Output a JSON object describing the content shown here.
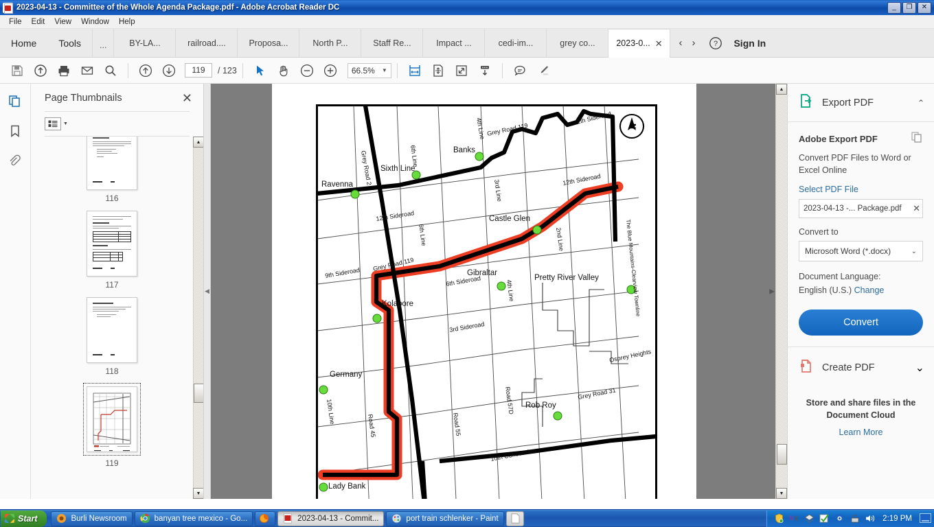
{
  "window": {
    "title": "2023-04-13 - Committee of the Whole Agenda Package.pdf - Adobe Acrobat Reader DC",
    "minimize": "_",
    "restore": "❐",
    "close": "✕"
  },
  "menubar": {
    "items": [
      "File",
      "Edit",
      "View",
      "Window",
      "Help"
    ]
  },
  "tabstrip": {
    "home": "Home",
    "tools": "Tools",
    "ellipsis": "...",
    "docs": [
      "BY-LA...",
      "railroad....",
      "Proposa...",
      "North P...",
      "Staff Re...",
      "Impact ...",
      "cedi-im...",
      "grey co..."
    ],
    "active_tab": "2023-0...",
    "active_close": "✕",
    "prev_arrow": "‹",
    "next_arrow": "›",
    "help": "?",
    "sign_in": "Sign In"
  },
  "toolbar": {
    "save": "save-icon",
    "upload": "upload-cloud-icon",
    "print": "print-icon",
    "email": "email-icon",
    "search": "search-icon",
    "page_up": "page-up-icon",
    "page_down": "page-down-icon",
    "page_current": "119",
    "page_total": "/ 123",
    "select_tool": "cursor-icon",
    "hand_tool": "hand-icon",
    "zoom_out": "zoom-out-icon",
    "zoom_in": "zoom-in-icon",
    "zoom_level": "66.5%",
    "zoom_caret": "▼",
    "fit_width": "fit-width-icon",
    "fit_page": "fit-page-icon",
    "fullscreen": "fullscreen-icon",
    "scroll_mode": "scroll-down-icon",
    "comment": "comment-icon",
    "highlight": "highlighter-icon"
  },
  "rail": {
    "thumbnails": "page-thumbnails-icon",
    "bookmarks": "bookmark-icon",
    "attachments": "attachment-icon"
  },
  "thumbnails_panel": {
    "title": "Page Thumbnails",
    "close": "✕",
    "list_button": "list-view-icon",
    "list_caret": "▼",
    "pages": [
      {
        "number": "116",
        "kind": "text"
      },
      {
        "number": "117",
        "kind": "table"
      },
      {
        "number": "118",
        "kind": "text"
      },
      {
        "number": "119",
        "kind": "map",
        "selected": true
      }
    ],
    "scroll_up": "▲",
    "scroll_down": "▼"
  },
  "document": {
    "scroll_up": "▲",
    "scroll_down": "▼",
    "collapse_handle": "▶",
    "expand_handle": "◀"
  },
  "map": {
    "compass_label": "N",
    "places": [
      "Ravenna",
      "Sixth Line",
      "Banks",
      "Castle Glen",
      "Gibraltar",
      "Kolapore",
      "Germany",
      "Pretty River Valley",
      "Rob Roy",
      "Osprey Heights",
      "Lady Bank"
    ],
    "roads": [
      "Grey Road 2",
      "Grey Road 119",
      "Grey Road 31",
      "4th Line",
      "6th Line",
      "3rd Line",
      "2nd Line",
      "12th Sideroad",
      "9th Sideroad",
      "6th Sideroad",
      "3rd Sideroad",
      "10th Line",
      "10th Concession",
      "Road 45",
      "Road 55",
      "Road 57D",
      "The Blue Mountains-Clearview Townline"
    ],
    "highlight_color": "#ed3d22",
    "node_color": "#66dd3a"
  },
  "export_panel": {
    "header": "Export PDF",
    "header_icon": "export-pdf-icon",
    "collapse_chevron": "⌃",
    "heading": "Adobe Export PDF",
    "heading_icon": "copy-docs-icon",
    "description": "Convert PDF Files to Word or Excel Online",
    "select_file_link": "Select PDF File",
    "file_value": "2023-04-13 -... Package.pdf",
    "file_clear": "✕",
    "convert_to_label": "Convert to",
    "convert_to_value": "Microsoft Word (*.docx)",
    "convert_to_caret": "⌄",
    "language_label": "Document Language:",
    "language_value": "English (U.S.)",
    "language_change": "Change",
    "convert_button": "Convert",
    "create_pdf": "Create PDF",
    "create_pdf_icon": "create-pdf-icon",
    "create_pdf_chevron": "⌄",
    "promo_title": "Store and share files in the Document Cloud",
    "promo_link": "Learn More"
  },
  "taskbar": {
    "start": "Start",
    "items": [
      {
        "label": "Burli Newsroom",
        "icon": "burli-icon",
        "active": false
      },
      {
        "label": "banyan tree mexico - Go...",
        "icon": "chrome-icon",
        "active": false
      },
      {
        "label": "",
        "icon": "firefox-icon",
        "active": false,
        "narrow": true
      },
      {
        "label": "2023-04-13 - Commit...",
        "icon": "acrobat-icon",
        "active": true
      },
      {
        "label": "port train schlenker - Paint",
        "icon": "paint-icon",
        "active": false
      },
      {
        "label": "",
        "icon": "document-icon",
        "active": false,
        "plain": true
      }
    ],
    "tray_icons": [
      "shield-icon",
      "onenote-clip-icon",
      "layers-icon",
      "checkmark-icon",
      "security-icon",
      "network-icon",
      "volume-icon"
    ],
    "clock": "2:19 PM",
    "show_desktop": "show-desktop-icon"
  }
}
